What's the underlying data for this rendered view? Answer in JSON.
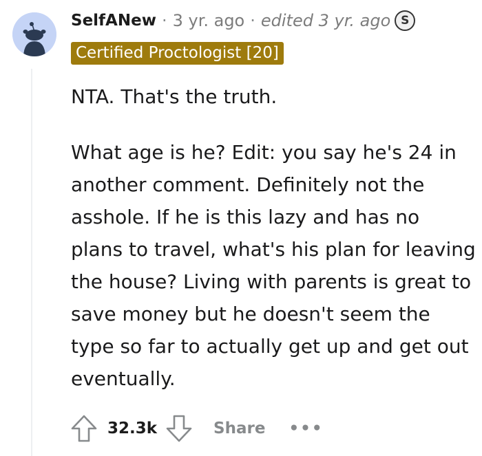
{
  "comment": {
    "author": "SelfANew",
    "separator": "·",
    "time_ago": "3 yr. ago",
    "edited_label": "edited 3 yr. ago",
    "award_icon": "S",
    "flair": "Certified Proctologist [20]",
    "paragraphs": [
      "NTA. That's the truth.",
      "What age is he? Edit: you say he's 24 in another comment. Definitely not the asshole. If he is this lazy and has no plans to travel, what's his plan for leaving the house? Living with parents is great to save money but he doesn't seem the type so far to actually get up and get out eventually."
    ],
    "score": "32.3k",
    "share_label": "Share",
    "more_label": "•••"
  },
  "icons": {
    "avatar": "reddit-snoo-avatar",
    "upvote": "upvote-arrow-icon",
    "downvote": "downvote-arrow-icon",
    "more": "more-options-icon"
  },
  "colors": {
    "flair_bg": "#9e7b0d",
    "avatar_bg": "#c5d4f6",
    "muted_text": "#878a8c"
  }
}
